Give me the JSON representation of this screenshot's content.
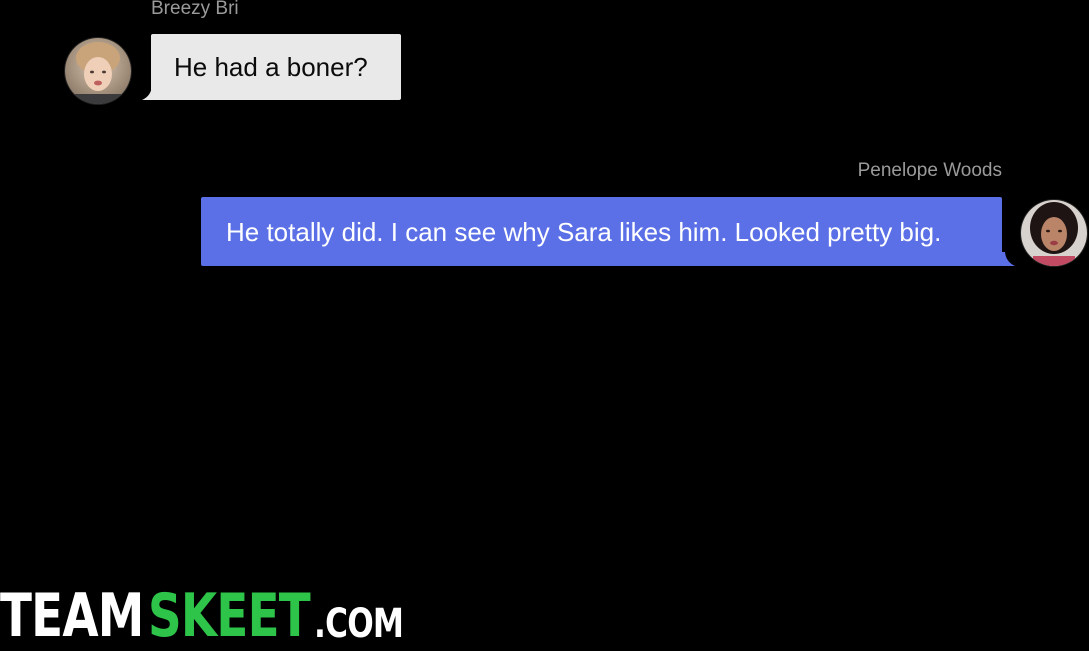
{
  "conversation": {
    "messages": [
      {
        "sender": "Breezy Bri",
        "text": "He had a boner?",
        "direction": "incoming"
      },
      {
        "sender": "Penelope Woods",
        "text": "He totally did. I can see why Sara likes him. Looked pretty big.",
        "direction": "outgoing"
      }
    ]
  },
  "watermark": {
    "part1": "TEAM",
    "part2": "SKEET",
    "part3": ".COM"
  },
  "colors": {
    "background": "#000000",
    "incoming_bubble": "#e9e9ea",
    "outgoing_bubble": "#5b70e6",
    "sender_name": "#9a9a9a",
    "logo_accent": "#2ec44a"
  }
}
